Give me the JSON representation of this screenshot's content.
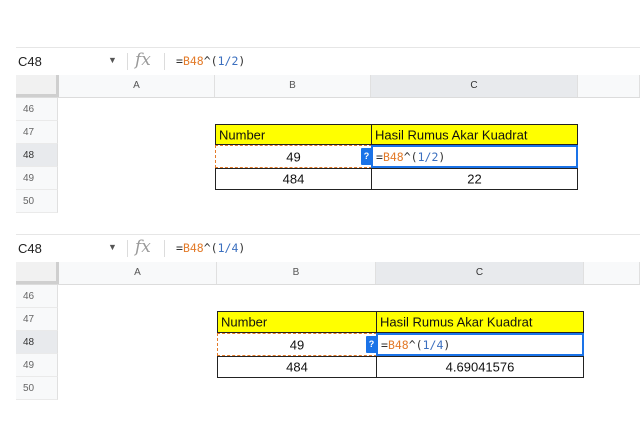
{
  "panels": [
    {
      "namebox": "C48",
      "fx_label": "fx",
      "formula": {
        "eq": "=",
        "ref": "B48",
        "op": "^",
        "open": "(",
        "num": "1/2",
        "close": ")"
      },
      "columns": [
        "A",
        "B",
        "C"
      ],
      "rows": [
        "46",
        "47",
        "48",
        "49",
        "50"
      ],
      "header_number": "Number",
      "header_result": "Hasil Rumus Akar Kuadrat",
      "b48": "49",
      "b49": "484",
      "c49": "22",
      "help": "?"
    },
    {
      "namebox": "C48",
      "fx_label": "fx",
      "formula": {
        "eq": "=",
        "ref": "B48",
        "op": "^",
        "open": "(",
        "num": "1/4",
        "close": ")"
      },
      "columns": [
        "A",
        "B",
        "C"
      ],
      "rows": [
        "46",
        "47",
        "48",
        "49",
        "50"
      ],
      "header_number": "Number",
      "header_result": "Hasil Rumus Akar Kuadrat",
      "b48": "49",
      "b49": "484",
      "c49": "4.69041576",
      "help": "?"
    }
  ],
  "colors": {
    "highlight": "#ffff00",
    "reference": "#e37b2a",
    "active_border": "#1a73e8",
    "number_token": "#3b6fbf"
  },
  "icons": {
    "namebox_dropdown": "chevron-down-icon",
    "formula": "fx-icon",
    "help": "help-badge-icon"
  }
}
